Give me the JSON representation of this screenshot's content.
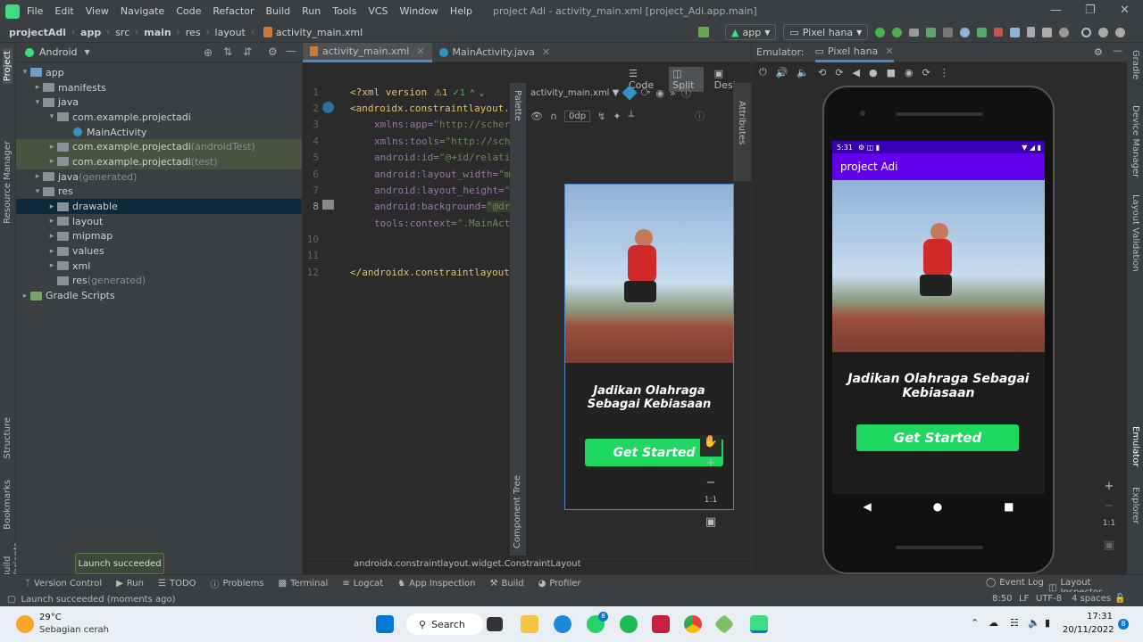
{
  "menubar": {
    "items": [
      "File",
      "Edit",
      "View",
      "Navigate",
      "Code",
      "Refactor",
      "Build",
      "Run",
      "Tools",
      "VCS",
      "Window",
      "Help"
    ],
    "title": "project Adi - activity_main.xml [project_Adi.app.main]"
  },
  "navbar": {
    "crumbs": [
      "projectAdi",
      "app",
      "src",
      "main",
      "res",
      "layout",
      "activity_main.xml"
    ],
    "run_config": "app",
    "device": "Pixel hana"
  },
  "leftstrip": {
    "project": "Project",
    "resource_manager": "Resource Manager",
    "structure": "Structure",
    "bookmarks": "Bookmarks",
    "build_variants": "Build Variants"
  },
  "project": {
    "view_label": "Android",
    "tree": [
      {
        "label": "app",
        "suffix": ""
      },
      {
        "label": "manifests",
        "suffix": ""
      },
      {
        "label": "java",
        "suffix": ""
      },
      {
        "label": "com.example.projectadi",
        "suffix": ""
      },
      {
        "label": "MainActivity",
        "suffix": ""
      },
      {
        "label": "com.example.projectadi",
        "suffix": " (androidTest)"
      },
      {
        "label": "com.example.projectadi",
        "suffix": " (test)"
      },
      {
        "label": "java",
        "suffix": " (generated)"
      },
      {
        "label": "res",
        "suffix": ""
      },
      {
        "label": "drawable",
        "suffix": ""
      },
      {
        "label": "layout",
        "suffix": ""
      },
      {
        "label": "mipmap",
        "suffix": ""
      },
      {
        "label": "values",
        "suffix": ""
      },
      {
        "label": "xml",
        "suffix": ""
      },
      {
        "label": "res",
        "suffix": " (generated)"
      },
      {
        "label": "Gradle Scripts",
        "suffix": ""
      }
    ]
  },
  "editor": {
    "tabs": [
      "activity_main.xml",
      "MainActivity.java"
    ],
    "modes": [
      "Code",
      "Split",
      "Design"
    ],
    "warnings": "1",
    "checks": "1",
    "line_numbers": [
      "1",
      "2",
      "3",
      "4",
      "5",
      "6",
      "7",
      "8",
      "10",
      "11",
      "12"
    ],
    "code": [
      {
        "a": "<?xml version",
        "b": ""
      },
      {
        "a": "<androidx.constraintlayout.",
        "b": ""
      },
      {
        "a": "xmlns:app=",
        "b": "\"http://scher"
      },
      {
        "a": "xmlns:tools=",
        "b": "\"http://sch"
      },
      {
        "a": "android:id=",
        "b": "\"@+id/relati"
      },
      {
        "a": "android:layout_width=",
        "b": "\"m"
      },
      {
        "a": "android:layout_height=",
        "b": "\""
      },
      {
        "a": "android:background=",
        "b": "\"@dr"
      },
      {
        "a": "tools:context=",
        "b": "\".MainAct"
      },
      {
        "a": "",
        "b": ""
      },
      {
        "a": "</androidx.constraintlayout",
        "b": ""
      }
    ],
    "design_file": "activity_main.xml",
    "dp_value": "0dp",
    "palette": "Palette",
    "component_tree": "Component Tree",
    "attributes": "Attributes",
    "zoom_ratio": "1:1",
    "status_path": "androidx.constraintlayout.widget.ConstraintLayout"
  },
  "preview": {
    "heading": "Jadikan Olahraga Sebagai Kebiasaan",
    "button": "Get Started"
  },
  "emulator": {
    "label": "Emulator:",
    "tab": "Pixel hana",
    "status_time": "5:31",
    "app_title": "project Adi",
    "heading": "Jadikan Olahraga Sebagai Kebiasaan",
    "button": "Get Started",
    "zoom_ratio": "1:1",
    "app_bar_color": "#6200ee",
    "button_color": "#1ed760"
  },
  "rightstrip": {
    "gradle": "Gradle",
    "device_manager": "Device Manager",
    "layout_validation": "Layout Validation",
    "emulator": "Emulator",
    "device_file_explorer": "Device File Explorer"
  },
  "bottombar": {
    "items": [
      "Version Control",
      "Run",
      "TODO",
      "Problems",
      "Terminal",
      "Logcat",
      "App Inspection",
      "Build",
      "Profiler"
    ],
    "right": [
      "Event Log",
      "Layout Inspector"
    ]
  },
  "toast": "Launch succeeded",
  "status": {
    "message": "Launch succeeded (moments ago)",
    "position": "8:50",
    "line_sep": "LF",
    "encoding": "UTF-8",
    "indent": "4 spaces"
  },
  "taskbar": {
    "temp": "29°C",
    "weather": "Sebagian cerah",
    "search": "Search",
    "whatsapp_badge": "8",
    "time": "17:31",
    "date": "20/11/2022",
    "notif": "8"
  }
}
